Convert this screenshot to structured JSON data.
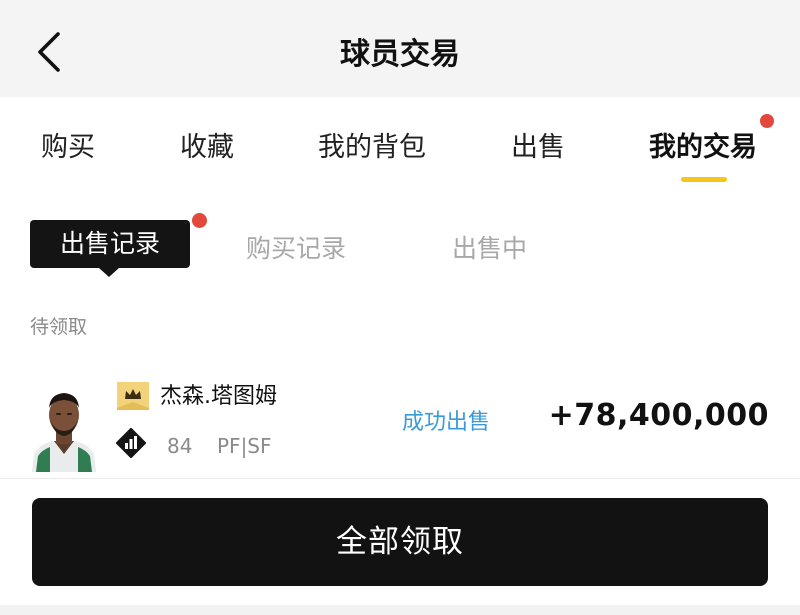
{
  "header": {
    "title": "球员交易",
    "back_icon": "chevron-left-icon"
  },
  "tabs": [
    {
      "label": "购买",
      "active": false
    },
    {
      "label": "收藏",
      "active": false
    },
    {
      "label": "我的背包",
      "active": false
    },
    {
      "label": "出售",
      "active": false
    },
    {
      "label": "我的交易",
      "active": true,
      "has_notification": true
    }
  ],
  "colors": {
    "accent": "#f5c518",
    "notification": "#e2483c",
    "status": "#3a9bd9",
    "button": "#121212"
  },
  "subtabs": [
    {
      "label": "出售记录",
      "active": true,
      "has_notification": true
    },
    {
      "label": "购买记录",
      "active": false
    },
    {
      "label": "出售中",
      "active": false
    }
  ],
  "section": {
    "label": "待领取"
  },
  "records": [
    {
      "player_name": "杰森.塔图姆",
      "tier_icon": "crown-badge-icon",
      "rating_icon": "rating-bars-icon",
      "rating": "84",
      "position": "PF|SF",
      "status": "成功出售",
      "amount": "+78,400,000"
    }
  ],
  "footer": {
    "claim_all_label": "全部领取"
  }
}
